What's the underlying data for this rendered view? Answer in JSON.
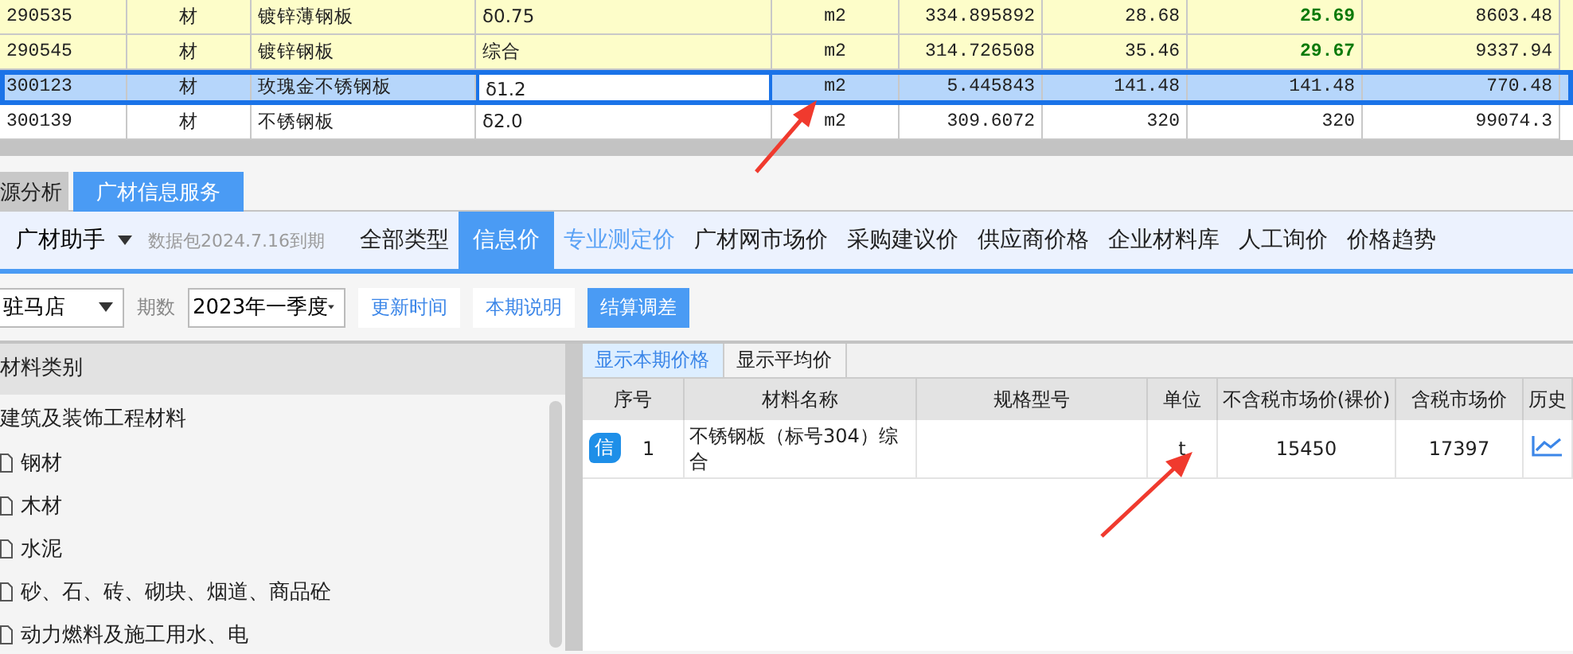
{
  "grid": {
    "rows": [
      {
        "cells": [
          "290535",
          "材",
          "镀锌薄钢板",
          "δ0.75",
          "m2",
          "334.895892",
          "28.68",
          "25.69",
          "8603.48"
        ],
        "tinted": true,
        "selected": false,
        "adjusted": true
      },
      {
        "cells": [
          "290545",
          "材",
          "镀锌钢板",
          "综合",
          "m2",
          "314.726508",
          "35.46",
          "29.67",
          "9337.94"
        ],
        "tinted": true,
        "selected": false,
        "adjusted": true
      },
      {
        "cells": [
          "300123",
          "材",
          "玫瑰金不锈钢板",
          "δ1.2",
          "m2",
          "5.445843",
          "141.48",
          "141.48",
          "770.48"
        ],
        "tinted": false,
        "selected": true,
        "adjusted": false
      },
      {
        "cells": [
          "300139",
          "材",
          "不锈钢板",
          "δ2.0",
          "m2",
          "309.6072",
          "320",
          "320",
          "99074.3"
        ],
        "tinted": false,
        "selected": false,
        "adjusted": false
      }
    ]
  },
  "module_tabs": [
    {
      "label": "源分析",
      "selected": false
    },
    {
      "label": "广材信息服务",
      "selected": true
    }
  ],
  "toolbar": {
    "assistant": "广材助手",
    "package": "数据包2024.7.16到期",
    "tabs": [
      {
        "label": "全部类型",
        "selected": false,
        "kind": "normal"
      },
      {
        "label": "信息价",
        "selected": true,
        "kind": "normal"
      },
      {
        "label": "专业测定价",
        "selected": false,
        "kind": "link"
      },
      {
        "label": "广材网市场价",
        "selected": false,
        "kind": "normal"
      },
      {
        "label": "采购建议价",
        "selected": false,
        "kind": "normal"
      },
      {
        "label": "供应商价格",
        "selected": false,
        "kind": "normal"
      },
      {
        "label": "企业材料库",
        "selected": false,
        "kind": "normal"
      },
      {
        "label": "人工询价",
        "selected": false,
        "kind": "normal"
      },
      {
        "label": "价格趋势",
        "selected": false,
        "kind": "normal"
      }
    ]
  },
  "filter": {
    "region": "驻马店",
    "period_label": "期数",
    "period": "2023年一季度",
    "buttons": [
      {
        "label": "更新时间",
        "kind": "outline"
      },
      {
        "label": "本期说明",
        "kind": "outline"
      },
      {
        "label": "结算调差",
        "kind": "primary"
      }
    ]
  },
  "categories": {
    "title": "材料类别",
    "tree": [
      {
        "label": "建筑及装饰工程材料",
        "children": [
          {
            "label": "钢材"
          },
          {
            "label": "木材"
          },
          {
            "label": "水泥"
          },
          {
            "label": "砂、石、砖、砌块、烟道、商品砼"
          },
          {
            "label": "动力燃料及施工用水、电"
          }
        ]
      }
    ]
  },
  "price_tabs": [
    {
      "label": "显示本期价格",
      "selected": true
    },
    {
      "label": "显示平均价",
      "selected": false
    }
  ],
  "price_table": {
    "columns": [
      "序号",
      "材料名称",
      "规格型号",
      "单位",
      "不含税市场价(裸价)",
      "含税市场价",
      "历史"
    ],
    "rows": [
      {
        "badge": "信",
        "cells": [
          "1",
          "不锈钢板（标号304）综合",
          "",
          "t",
          "15450",
          "17397"
        ]
      }
    ]
  }
}
